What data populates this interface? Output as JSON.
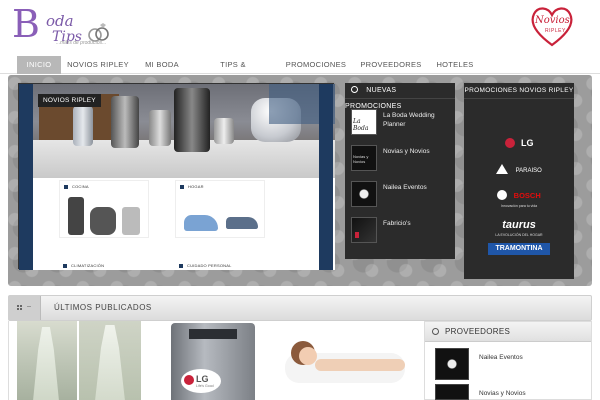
{
  "header": {
    "logo_letter": "B",
    "logo_line1": "oda",
    "logo_line2": "Tips",
    "tagline": "...miles de productos...",
    "partner_logo_line1": "Novios",
    "partner_logo_line2": "RIPLEY"
  },
  "nav": {
    "items": [
      {
        "label": "INICIO",
        "active": true
      },
      {
        "label": "NOVIOS RIPLEY",
        "active": false
      },
      {
        "label": "MI BODA",
        "active": false
      },
      {
        "label": "TIPS & TENDENCIAS",
        "active": false
      },
      {
        "label": "PROMOCIONES",
        "active": false
      },
      {
        "label": "PROVEEDORES",
        "active": false
      },
      {
        "label": "HOTELES",
        "active": false
      }
    ]
  },
  "slider": {
    "tag": "NOVIOS RIPLEY",
    "categories": [
      "COCINA",
      "HOGAR",
      "CLIMATIZACIÓN",
      "CUIDADO PERSONAL"
    ]
  },
  "nuevas_promociones": {
    "title": "NUEVAS PROMOCIONES",
    "icon": "circle-icon",
    "items": [
      {
        "label": "La Boda Wedding Planner",
        "thumb_text": "La Boda"
      },
      {
        "label": "Novias y Novios",
        "thumb_text": "Novias y Novios"
      },
      {
        "label": "Nailea Eventos",
        "thumb_text": ""
      },
      {
        "label": "Fabricio's",
        "thumb_text": ""
      }
    ]
  },
  "promociones_novios": {
    "title": "PROMOCIONES NOVIOS RIPLEY",
    "brands": [
      {
        "name": "LG",
        "color": "#ffffff"
      },
      {
        "name": "PARAISO",
        "color": "#ffffff"
      },
      {
        "name": "BOSCH",
        "sub": "Innovación para tu vida",
        "color": "#ffffff"
      },
      {
        "name": "taurus",
        "sub": "LA EVOLUCIÓN DEL HOGAR",
        "color": "#ffffff"
      },
      {
        "name": "TRAMONTINA",
        "color": "#1f56a8"
      }
    ]
  },
  "ultimos": {
    "title": "ÚLTIMOS PUBLICADOS",
    "posts": [
      {
        "alt": "wedding-dress-1"
      },
      {
        "alt": "wedding-dress-2"
      },
      {
        "alt": "lg-washing-machine",
        "brand": "LG",
        "brand_sub": "Life's Good"
      },
      {
        "alt": "sleeping-woman"
      }
    ]
  },
  "proveedores": {
    "title": "PROVEEDORES",
    "items": [
      {
        "label": "Nailea Eventos"
      },
      {
        "label": "Novias y Novios"
      }
    ]
  },
  "colors": {
    "accent_purple": "#8a5fb8",
    "ripley_red": "#c9223a",
    "panel_dark": "#2b2b2b",
    "slider_blue": "#1e3a5f",
    "tramontina_blue": "#1f56a8"
  }
}
